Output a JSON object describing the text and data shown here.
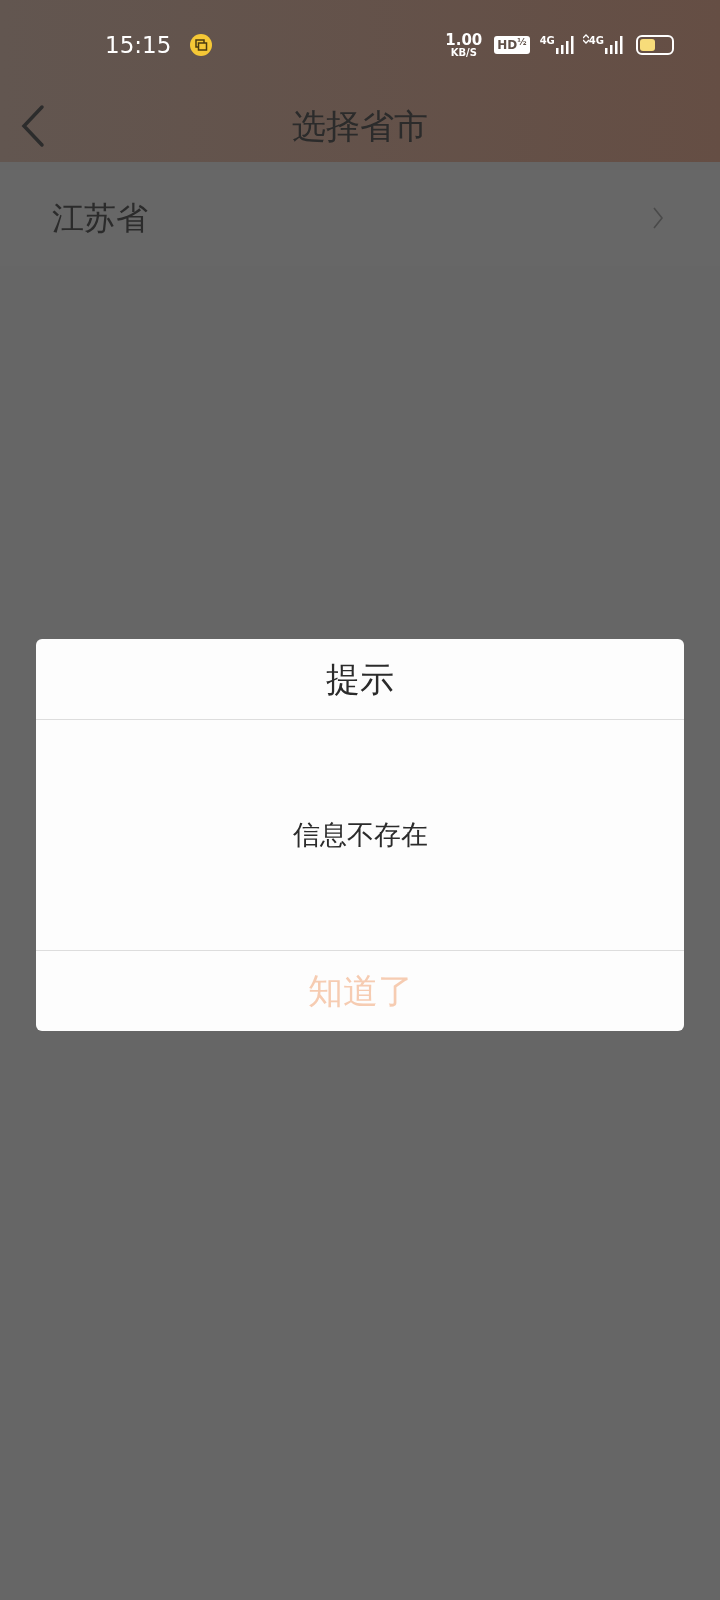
{
  "status_bar": {
    "time": "15:15",
    "speed_value": "1.00",
    "speed_unit": "KB/S",
    "hd_badge": "HD$^{½}$",
    "network_1": "4G",
    "network_2": "4G"
  },
  "header": {
    "title": "选择省市"
  },
  "list": {
    "items": [
      {
        "label": "江苏省"
      }
    ]
  },
  "dialog": {
    "title": "提示",
    "message": "信息不存在",
    "button": "知道了"
  }
}
